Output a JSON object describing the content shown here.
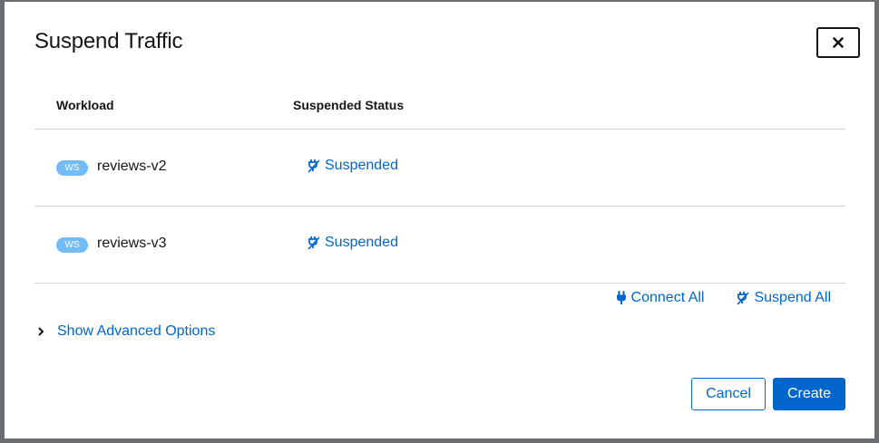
{
  "modal": {
    "title": "Suspend Traffic",
    "close_icon": "close-icon"
  },
  "table": {
    "columns": [
      "Workload",
      "Suspended Status"
    ],
    "rows": [
      {
        "badge": "WS",
        "name": "reviews-v2",
        "status": "Suspended",
        "status_icon": "unplugged-icon"
      },
      {
        "badge": "WS",
        "name": "reviews-v3",
        "status": "Suspended",
        "status_icon": "unplugged-icon"
      }
    ]
  },
  "bulk_actions": {
    "connect_all": "Connect All",
    "connect_icon": "plug-icon",
    "suspend_all": "Suspend All",
    "suspend_icon": "unplugged-icon"
  },
  "advanced": {
    "toggle_label": "Show Advanced Options",
    "toggle_icon": "chevron-right-icon"
  },
  "footer": {
    "cancel_label": "Cancel",
    "create_label": "Create"
  },
  "colors": {
    "link": "#0066cc",
    "badge": "#73bcf7",
    "primary": "#0066cc",
    "border": "#d2d2d2"
  }
}
